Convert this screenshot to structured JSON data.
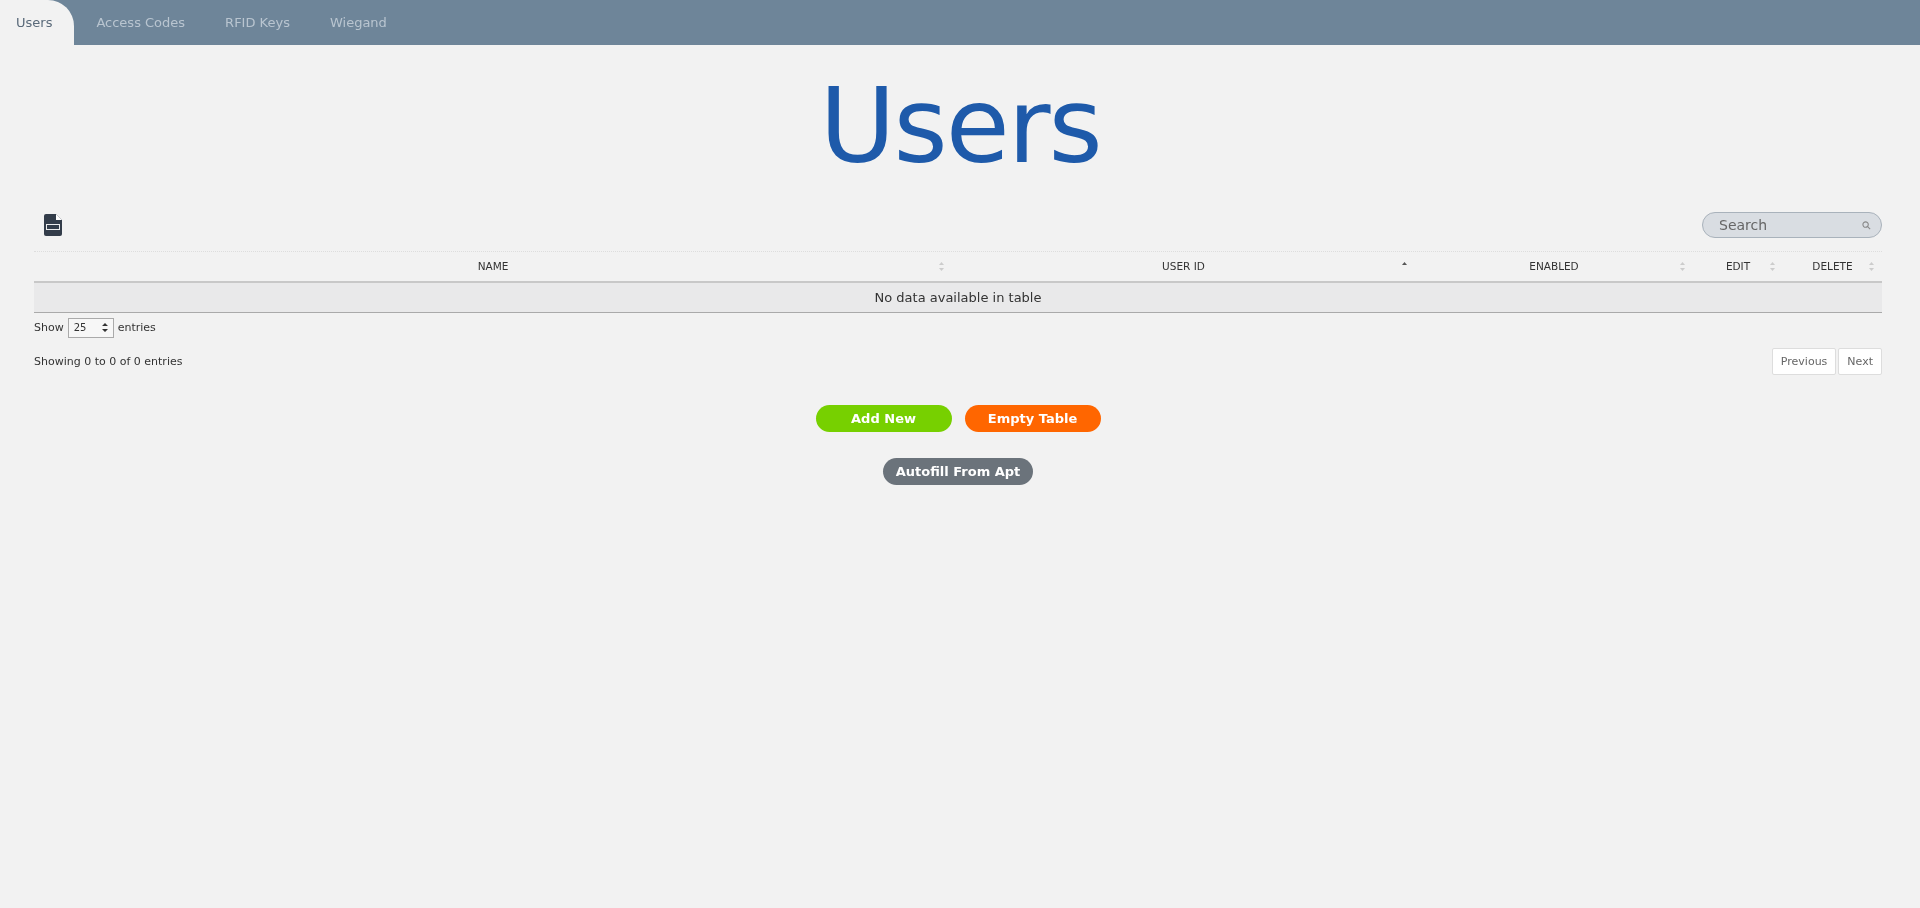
{
  "tabs": [
    {
      "label": "Users",
      "selected": true
    },
    {
      "label": "Access Codes",
      "selected": false
    },
    {
      "label": "RFID Keys",
      "selected": false
    },
    {
      "label": "Wiegand",
      "selected": false
    }
  ],
  "title": "Users",
  "search": {
    "placeholder": "Search"
  },
  "table": {
    "columns": [
      {
        "label": "NAME",
        "sorted": false
      },
      {
        "label": "USER ID",
        "sorted": true
      },
      {
        "label": "ENABLED",
        "sorted": false
      },
      {
        "label": "EDIT",
        "sorted": false
      },
      {
        "label": "DELETE",
        "sorted": false
      }
    ],
    "empty_message": "No data available in table"
  },
  "length": {
    "before": "Show",
    "value": "25",
    "after": "entries"
  },
  "info": "Showing 0 to 0 of 0 entries",
  "pagination": [
    "Previous",
    "Next"
  ],
  "buttons": [
    {
      "label": "Add New",
      "kind": "add"
    },
    {
      "label": "Empty Table",
      "kind": "empty"
    },
    {
      "label": "Autofill From Apt",
      "kind": "autofill"
    }
  ]
}
